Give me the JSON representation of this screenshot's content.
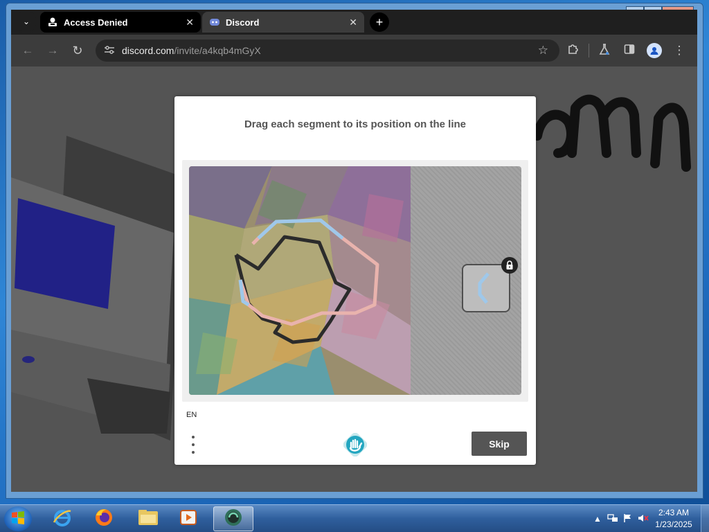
{
  "browser": {
    "tabs": [
      {
        "title": "Access Denied",
        "active": false,
        "favicon": "incognito-stamp-icon"
      },
      {
        "title": "Discord",
        "active": true,
        "favicon": "discord-icon"
      }
    ],
    "tab_close_glyph": "✕",
    "new_tab_glyph": "+",
    "url_host": "discord.com",
    "url_path": "/invite/a4kqb4mGyX"
  },
  "captcha": {
    "prompt": "Drag each segment to its position on the line",
    "language": "EN",
    "skip_label": "Skip",
    "colors": {
      "button_bg": "#555555",
      "line_dark": "#2b2b2b",
      "line_pink": "#e9b3ad",
      "line_blue": "#9fc8ea"
    }
  },
  "taskbar": {
    "time": "2:43 AM",
    "date": "1/23/2025",
    "pinned": [
      "internet-explorer-icon",
      "firefox-icon",
      "file-explorer-icon",
      "media-player-icon",
      "active-app-icon"
    ]
  }
}
